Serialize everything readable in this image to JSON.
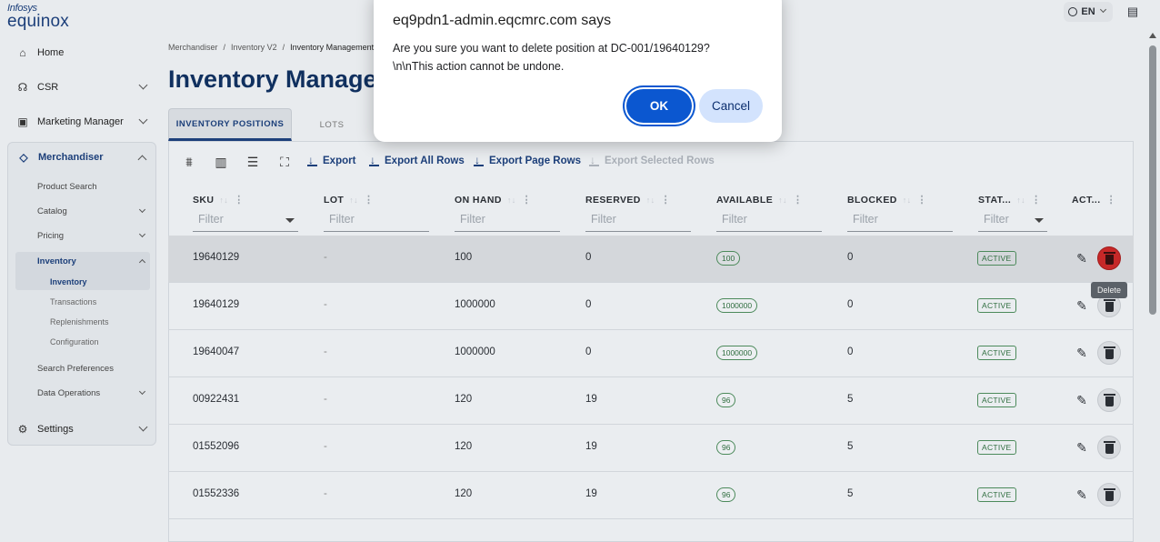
{
  "app": {
    "brand_top": "Infosys",
    "brand_name": "equinox",
    "language": "EN"
  },
  "sidebar": {
    "home": "Home",
    "csr": "CSR",
    "marketing": "Marketing Manager",
    "merchandiser": "Merchandiser",
    "sub_items": [
      "Product Search",
      "Catalog",
      "Pricing",
      "Inventory"
    ],
    "inventory_children": [
      "Inventory",
      "Transactions",
      "Replenishments",
      "Configuration"
    ],
    "search_prefs": "Search Preferences",
    "data_ops": "Data Operations",
    "settings": "Settings"
  },
  "breadcrumb": [
    "Merchandiser",
    "Inventory V2",
    "Inventory Management"
  ],
  "page_title": "Inventory Management",
  "tabs": [
    "INVENTORY POSITIONS",
    "LOTS"
  ],
  "toolbar": {
    "export": "Export",
    "export_all": "Export All Rows",
    "export_page": "Export Page Rows",
    "export_selected": "Export Selected Rows"
  },
  "columns": [
    "SKU",
    "LOT",
    "ON HAND",
    "RESERVED",
    "AVAILABLE",
    "BLOCKED",
    "STAT...",
    "ACT..."
  ],
  "filter_placeholder": "Filter",
  "rows": [
    {
      "sku": "19640129",
      "lot": "-",
      "on_hand": "100",
      "reserved": "0",
      "available": "100",
      "blocked": "0",
      "status": "ACTIVE"
    },
    {
      "sku": "19640129",
      "lot": "-",
      "on_hand": "1000000",
      "reserved": "0",
      "available": "1000000",
      "blocked": "0",
      "status": "ACTIVE"
    },
    {
      "sku": "19640047",
      "lot": "-",
      "on_hand": "1000000",
      "reserved": "0",
      "available": "1000000",
      "blocked": "0",
      "status": "ACTIVE"
    },
    {
      "sku": "00922431",
      "lot": "-",
      "on_hand": "120",
      "reserved": "19",
      "available": "96",
      "blocked": "5",
      "status": "ACTIVE"
    },
    {
      "sku": "01552096",
      "lot": "-",
      "on_hand": "120",
      "reserved": "19",
      "available": "96",
      "blocked": "5",
      "status": "ACTIVE"
    },
    {
      "sku": "01552336",
      "lot": "-",
      "on_hand": "120",
      "reserved": "19",
      "available": "96",
      "blocked": "5",
      "status": "ACTIVE"
    }
  ],
  "tooltip": "Delete",
  "dialog": {
    "title": "eq9pdn1-admin.eqcmrc.com says",
    "message_line1": "Are you sure you want to delete position at DC-001/19640129?",
    "message_line2": "\\n\\nThis action cannot be undone.",
    "ok": "OK",
    "cancel": "Cancel"
  }
}
